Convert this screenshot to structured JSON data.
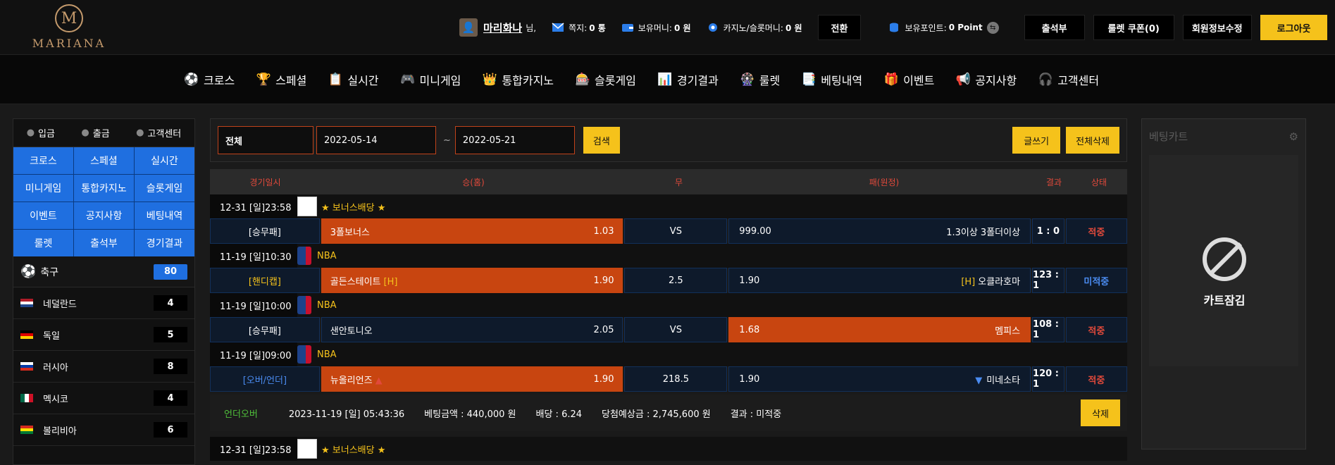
{
  "logo": {
    "text": "MARIANA",
    "mark": "M"
  },
  "user": {
    "name": "마리화나",
    "suffix": "님,",
    "messages_label": "쪽지:",
    "messages_value": "0 통",
    "money_label": "보유머니:",
    "money_value": "0 원",
    "casino_label": "카지노/슬롯머니:",
    "casino_value": "0 원",
    "switch_button": "전환",
    "points_label": "보유포인트:",
    "points_value": "0 Point",
    "attendance_button": "출석부",
    "roulette_button": "룰렛 쿠폰(0)",
    "profile_button": "회원정보수정",
    "logout_button": "로그아웃"
  },
  "nav": [
    {
      "label": "크로스",
      "icon": "soccer-ball-icon",
      "glyph": "⚽"
    },
    {
      "label": "스페셜",
      "icon": "trophy-icon",
      "glyph": "🏆"
    },
    {
      "label": "실시간",
      "icon": "live-icon",
      "glyph": "📋"
    },
    {
      "label": "미니게임",
      "icon": "minigame-icon",
      "glyph": "🎮"
    },
    {
      "label": "통합카지노",
      "icon": "casino-icon",
      "glyph": "👑"
    },
    {
      "label": "슬롯게임",
      "icon": "slot-icon",
      "glyph": "🎰"
    },
    {
      "label": "경기결과",
      "icon": "result-icon",
      "glyph": "📊"
    },
    {
      "label": "룰렛",
      "icon": "roulette-icon",
      "glyph": "🎡"
    },
    {
      "label": "베팅내역",
      "icon": "history-icon",
      "glyph": "📑"
    },
    {
      "label": "이벤트",
      "icon": "gift-icon",
      "glyph": "🎁"
    },
    {
      "label": "공지사항",
      "icon": "megaphone-icon",
      "glyph": "📢"
    },
    {
      "label": "고객센터",
      "icon": "support-icon",
      "glyph": "🎧"
    }
  ],
  "sidebar": {
    "top": [
      {
        "label": "입금",
        "icon": "coins-icon"
      },
      {
        "label": "출금",
        "icon": "coins-icon"
      },
      {
        "label": "고객센터",
        "icon": "support-icon"
      }
    ],
    "grid": [
      "크로스",
      "스페셜",
      "실시간",
      "미니게임",
      "통합카지노",
      "슬롯게임",
      "이벤트",
      "공지사항",
      "베팅내역",
      "룰렛",
      "출석부",
      "경기결과"
    ],
    "sport": {
      "name": "축구",
      "count": "80"
    },
    "countries": [
      {
        "name": "네덜란드",
        "count": "4",
        "flag": "nl"
      },
      {
        "name": "독일",
        "count": "5",
        "flag": "de"
      },
      {
        "name": "러시아",
        "count": "8",
        "flag": "ru"
      },
      {
        "name": "멕시코",
        "count": "4",
        "flag": "mx"
      },
      {
        "name": "볼리비아",
        "count": "6",
        "flag": "bo"
      }
    ]
  },
  "filter": {
    "type": "전체",
    "date_from": "2022-05-14",
    "sep": "~",
    "date_to": "2022-05-21",
    "search_button": "검색",
    "write_button": "글쓰기",
    "delete_all_button": "전체삭제"
  },
  "table_head": [
    "경기일시",
    "승(홈)",
    "무",
    "패(원정)",
    "결과",
    "상태"
  ],
  "games": [
    {
      "date": "12-31 [일]23:58",
      "league_type": "bonus",
      "league": "★ 보너스배당 ★",
      "bet_type": "[승무패]",
      "bet_class": "type",
      "home": "3폴보너스",
      "home_odds": "1.03",
      "home_sel": true,
      "home_badge": "",
      "mid": "VS",
      "away_odds": "999.00",
      "away": "1.3이상 3폴더이상",
      "away_sel": false,
      "away_badge": "",
      "score": "1 : 0",
      "state": "적중",
      "state_class": "red",
      "home_arrow": "",
      "away_arrow": ""
    },
    {
      "date": "11-19 [일]10:30",
      "league_type": "nba",
      "league": "NBA",
      "bet_type": "[핸디캡]",
      "bet_class": "type yellow",
      "home": "골든스테이트",
      "home_odds": "1.90",
      "home_sel": true,
      "home_badge": "[H]",
      "mid": "2.5",
      "away_odds": "1.90",
      "away": "오클라호마",
      "away_sel": false,
      "away_badge": "[H]",
      "score": "123 : 1",
      "state": "미적중",
      "state_class": "bluet",
      "home_arrow": "",
      "away_arrow": ""
    },
    {
      "date": "11-19 [일]10:00",
      "league_type": "nba",
      "league": "NBA",
      "bet_type": "[승무패]",
      "bet_class": "type",
      "home": "샌안토니오",
      "home_odds": "2.05",
      "home_sel": false,
      "home_badge": "",
      "mid": "VS",
      "away_odds": "1.68",
      "away": "멤피스",
      "away_sel": true,
      "away_badge": "",
      "score": "108 : 1",
      "state": "적중",
      "state_class": "red",
      "home_arrow": "",
      "away_arrow": ""
    },
    {
      "date": "11-19 [일]09:00",
      "league_type": "nba",
      "league": "NBA",
      "bet_type": "[오버/언더]",
      "bet_class": "type blue",
      "home": "뉴올리언즈",
      "home_odds": "1.90",
      "home_sel": true,
      "home_badge": "",
      "mid": "218.5",
      "away_odds": "1.90",
      "away": "미네소타",
      "away_sel": false,
      "away_badge": "",
      "score": "120 : 1",
      "state": "적중",
      "state_class": "red",
      "home_arrow": "▲",
      "away_arrow": "▼"
    }
  ],
  "summary": {
    "type": "언더오버",
    "datetime": "2023-11-19 [일] 05:43:36",
    "amount": "베팅금액 : 440,000 원",
    "odds": "배당 : 6.24",
    "expected": "당첨예상금 : 2,745,600 원",
    "result": "결과 : 미적중",
    "delete_button": "삭제"
  },
  "next_row": {
    "date": "12-31 [일]23:58",
    "league": "★ 보너스배당 ★"
  },
  "cart": {
    "title": "베팅카트",
    "lock_text": "카트잠김"
  },
  "colors": {
    "accent": "#f5c21b",
    "blue": "#1f6fe0",
    "orange": "#c84510",
    "red": "#e0493b"
  }
}
